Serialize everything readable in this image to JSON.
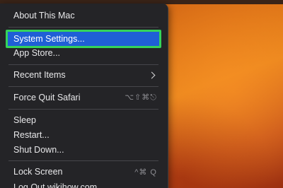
{
  "menu": {
    "items": [
      {
        "label": "About This Mac"
      },
      {
        "label": "System Settings...",
        "selected": true
      },
      {
        "label": "App Store..."
      },
      {
        "label": "Recent Items",
        "icon": "chevron-right-icon"
      },
      {
        "label": "Force Quit Safari",
        "shortcut": "⌥⇧⌘⎋"
      },
      {
        "label": "Sleep"
      },
      {
        "label": "Restart..."
      },
      {
        "label": "Shut Down..."
      },
      {
        "label": "Lock Screen",
        "shortcut": "^⌘ Q"
      },
      {
        "label": "Log Out wikihow.com..."
      }
    ]
  },
  "colors": {
    "menu_background": "#242427",
    "selection": "#1f5fd6",
    "highlight_outline": "#35d35a",
    "wallpaper": "#de7418"
  }
}
